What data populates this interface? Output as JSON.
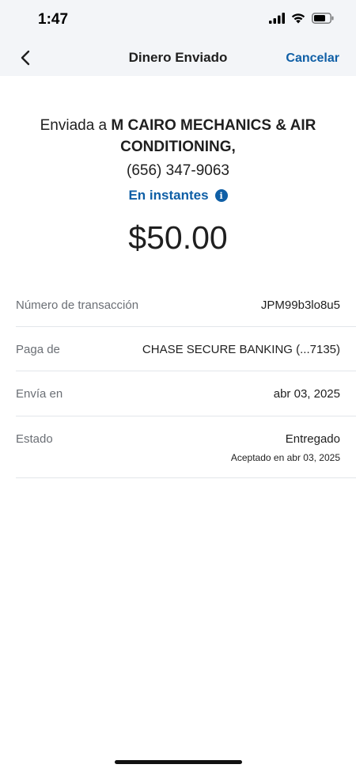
{
  "status_bar": {
    "time": "1:47"
  },
  "nav": {
    "title": "Dinero Enviado",
    "cancel_label": "Cancelar"
  },
  "summary": {
    "recipient_prefix": "Enviada a",
    "recipient_name": "M CAIRO MECHANICS & AIR CONDITIONING,",
    "phone": "(656) 347-9063",
    "speed": "En instantes",
    "info_glyph": "i",
    "amount": "$50.00"
  },
  "details": {
    "transaction": {
      "label": "Número de transacción",
      "value": "JPM99b3lo8u5"
    },
    "pay_from": {
      "label": "Paga de",
      "value": "CHASE SECURE BANKING (...7135)"
    },
    "send_on": {
      "label": "Envía en",
      "value": "abr 03, 2025"
    },
    "status": {
      "label": "Estado",
      "value": "Entregado",
      "subvalue": "Aceptado en abr 03, 2025"
    }
  },
  "colors": {
    "accent": "#0f5fa6",
    "header_bg": "#f3f5f8",
    "divider": "#e3e6ea"
  }
}
